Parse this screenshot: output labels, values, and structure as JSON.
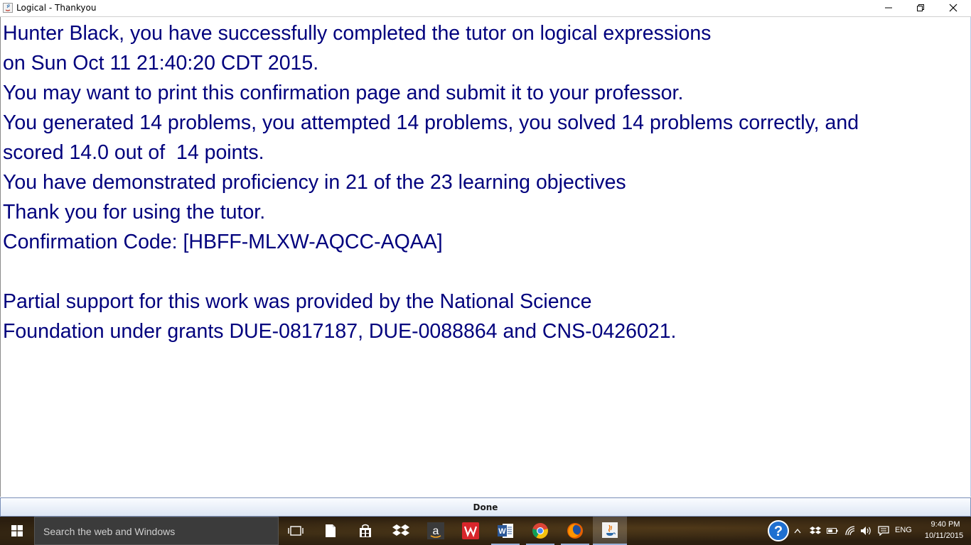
{
  "window": {
    "title": "Logical - Thankyou",
    "minimize_icon": "minimize-icon",
    "maximize_icon": "restore-icon",
    "close_icon": "close-icon"
  },
  "message": {
    "lines": [
      "Hunter Black, you have successfully completed the tutor on logical expressions",
      "on Sun Oct 11 21:40:20 CDT 2015.",
      "You may want to print this confirmation page and submit it to your professor.",
      "You generated 14 problems, you attempted 14 problems, you solved 14 problems correctly, and",
      "scored 14.0 out of  14 points.",
      "You have demonstrated proficiency in 21 of the 23 learning objectives",
      "Thank you for using the tutor.",
      "Confirmation Code: [HBFF-MLXW-AQCC-AQAA]",
      "",
      "Partial support for this work was provided by the National Science",
      "Foundation under grants DUE-0817187, DUE-0088864 and CNS-0426021."
    ],
    "color": "#00007d"
  },
  "done_button": {
    "label": "Done"
  },
  "taskbar": {
    "search_placeholder": "Search the web and Windows",
    "apps": [
      "task-view-icon",
      "file-icon",
      "store-icon",
      "dropbox-icon",
      "amazon-icon",
      "wps-icon",
      "word-icon",
      "chrome-icon",
      "firefox-icon",
      "java-icon"
    ],
    "tray": {
      "language": "ENG",
      "time": "9:40 PM",
      "date": "10/11/2015"
    }
  }
}
